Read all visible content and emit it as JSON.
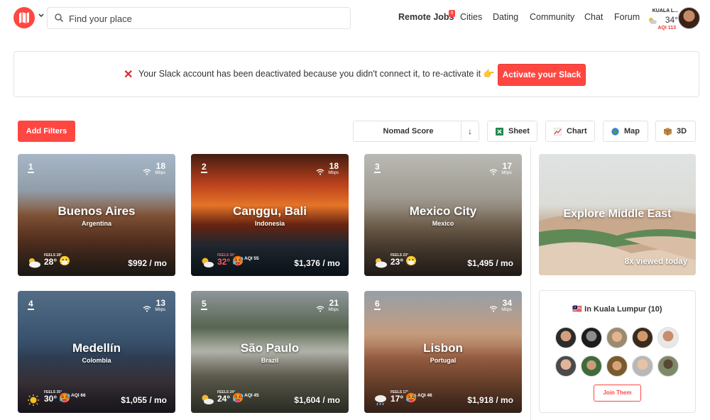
{
  "header": {
    "search_placeholder": "Find your place",
    "nav": {
      "remote_jobs": "Remote Jobs",
      "remote_jobs_badge": "9",
      "cities": "Cities",
      "dating": "Dating",
      "community": "Community",
      "chat": "Chat",
      "forum": "Forum"
    },
    "weather": {
      "city": "KUALA L...",
      "temp": "34°",
      "aqi": "AQI 113"
    }
  },
  "alert": {
    "message": "Your Slack account has been deactivated because you didn't connect it, to re-activate it 👉",
    "button": "Activate your Slack"
  },
  "toolbar": {
    "add_filters": "Add Filters",
    "sort_label": "Nomad Score",
    "sort_direction": "↓",
    "sheet": "Sheet",
    "chart": "Chart",
    "map": "Map",
    "three_d": "3D"
  },
  "cities": [
    {
      "rank": "1",
      "speed": "18",
      "unit": "Mbps",
      "name": "Buenos Aires",
      "country": "Argentina",
      "feels": "FEELS 28°",
      "temp": "28°",
      "aqi": "",
      "cost": "$992 / mo",
      "icon": "partly-cloudy",
      "hot": false
    },
    {
      "rank": "2",
      "speed": "18",
      "unit": "Mbps",
      "name": "Canggu, Bali",
      "country": "Indonesia",
      "feels": "FEELS 35°",
      "temp": "32°",
      "aqi": "AQI 55",
      "cost": "$1,376 / mo",
      "icon": "sun-cloud",
      "hot": true
    },
    {
      "rank": "3",
      "speed": "17",
      "unit": "Mbps",
      "name": "Mexico City",
      "country": "Mexico",
      "feels": "FEELS 23°",
      "temp": "23°",
      "aqi": "",
      "cost": "$1,495 / mo",
      "icon": "partly-cloudy",
      "hot": false
    },
    {
      "rank": "4",
      "speed": "13",
      "unit": "Mbps",
      "name": "Medellín",
      "country": "Colombia",
      "feels": "FEELS 35°",
      "temp": "30°",
      "aqi": "AQI 66",
      "cost": "$1,055 / mo",
      "icon": "sunny",
      "hot": false
    },
    {
      "rank": "5",
      "speed": "21",
      "unit": "Mbps",
      "name": "São Paulo",
      "country": "Brazil",
      "feels": "FEELS 24°",
      "temp": "24°",
      "aqi": "AQI 45",
      "cost": "$1,604 / mo",
      "icon": "sun-cloud",
      "hot": false
    },
    {
      "rank": "6",
      "speed": "34",
      "unit": "Mbps",
      "name": "Lisbon",
      "country": "Portugal",
      "feels": "FEELS 17°",
      "temp": "17°",
      "aqi": "AQI 46",
      "cost": "$1,918 / mo",
      "icon": "rain-cloud",
      "hot": false
    }
  ],
  "explore": {
    "title": "Explore Middle East",
    "views": "8x viewed today"
  },
  "members": {
    "title": "🇲🇾 In Kuala Lumpur (10)",
    "join": "Join Them"
  }
}
